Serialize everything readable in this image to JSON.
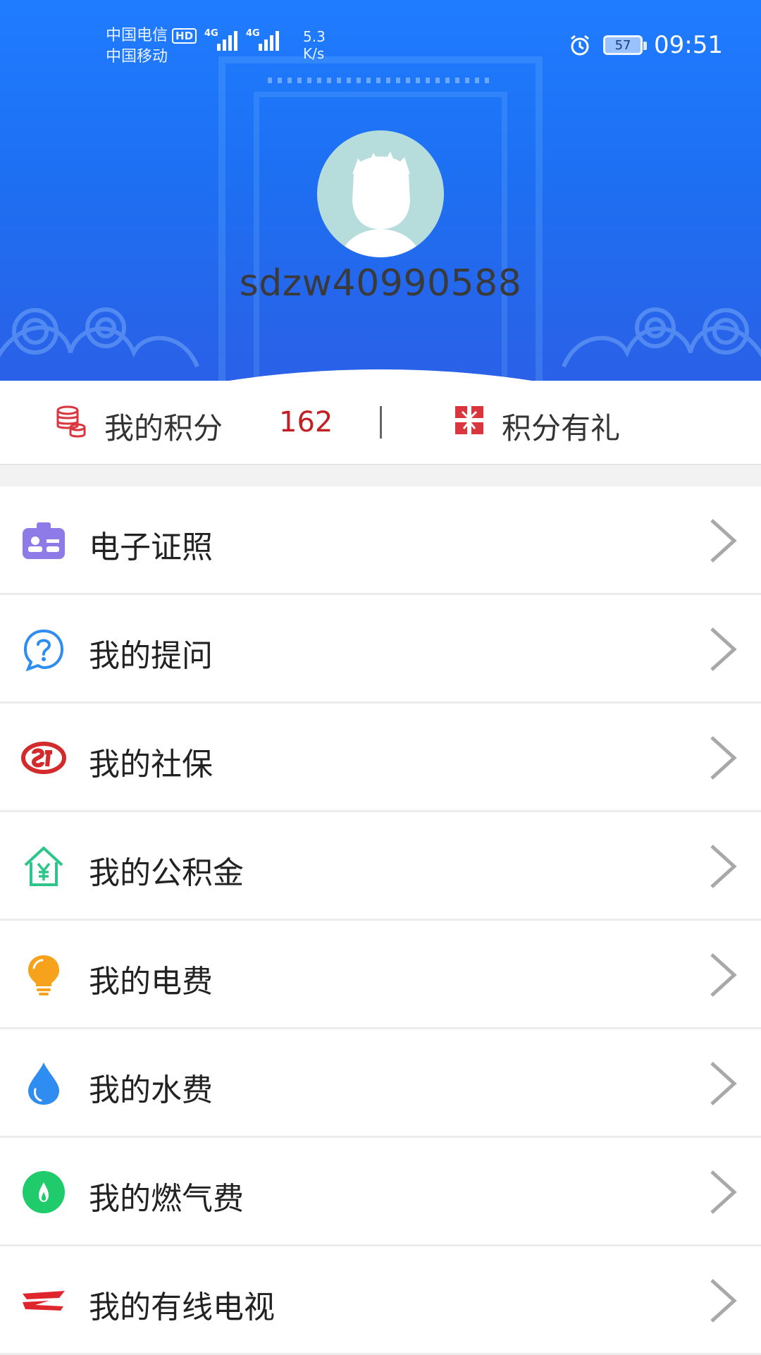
{
  "status_bar": {
    "carrier_1": "中国电信",
    "carrier_1_badge": "HD",
    "carrier_2": "中国移动",
    "network_1": "4G",
    "network_2": "4G",
    "speed_value": "5.3",
    "speed_unit": "K/s",
    "battery": "57",
    "time": "09:51"
  },
  "profile": {
    "username": "sdzw40990588"
  },
  "points": {
    "label": "我的积分",
    "value": "162",
    "gift_label": "积分有礼"
  },
  "menu": {
    "items": [
      {
        "label": "电子证照",
        "icon": "id-card-icon"
      },
      {
        "label": "我的提问",
        "icon": "question-bubble-icon"
      },
      {
        "label": "我的社保",
        "icon": "social-security-icon"
      },
      {
        "label": "我的公积金",
        "icon": "housing-fund-icon"
      },
      {
        "label": "我的电费",
        "icon": "light-bulb-icon"
      },
      {
        "label": "我的水费",
        "icon": "water-drop-icon"
      },
      {
        "label": "我的燃气费",
        "icon": "gas-flame-icon"
      },
      {
        "label": "我的有线电视",
        "icon": "cable-tv-icon"
      }
    ]
  },
  "colors": {
    "header_blue": "#1f7cff",
    "points_red": "#c21f25",
    "id_purple": "#8f7be8",
    "question_blue": "#2f8cf0",
    "social_red": "#d32b2b",
    "fund_green": "#2cc58a",
    "bulb_orange": "#f6a21c",
    "water_blue": "#2f8cf0",
    "gas_green": "#1fcb6b",
    "tv_red": "#e0262d"
  }
}
